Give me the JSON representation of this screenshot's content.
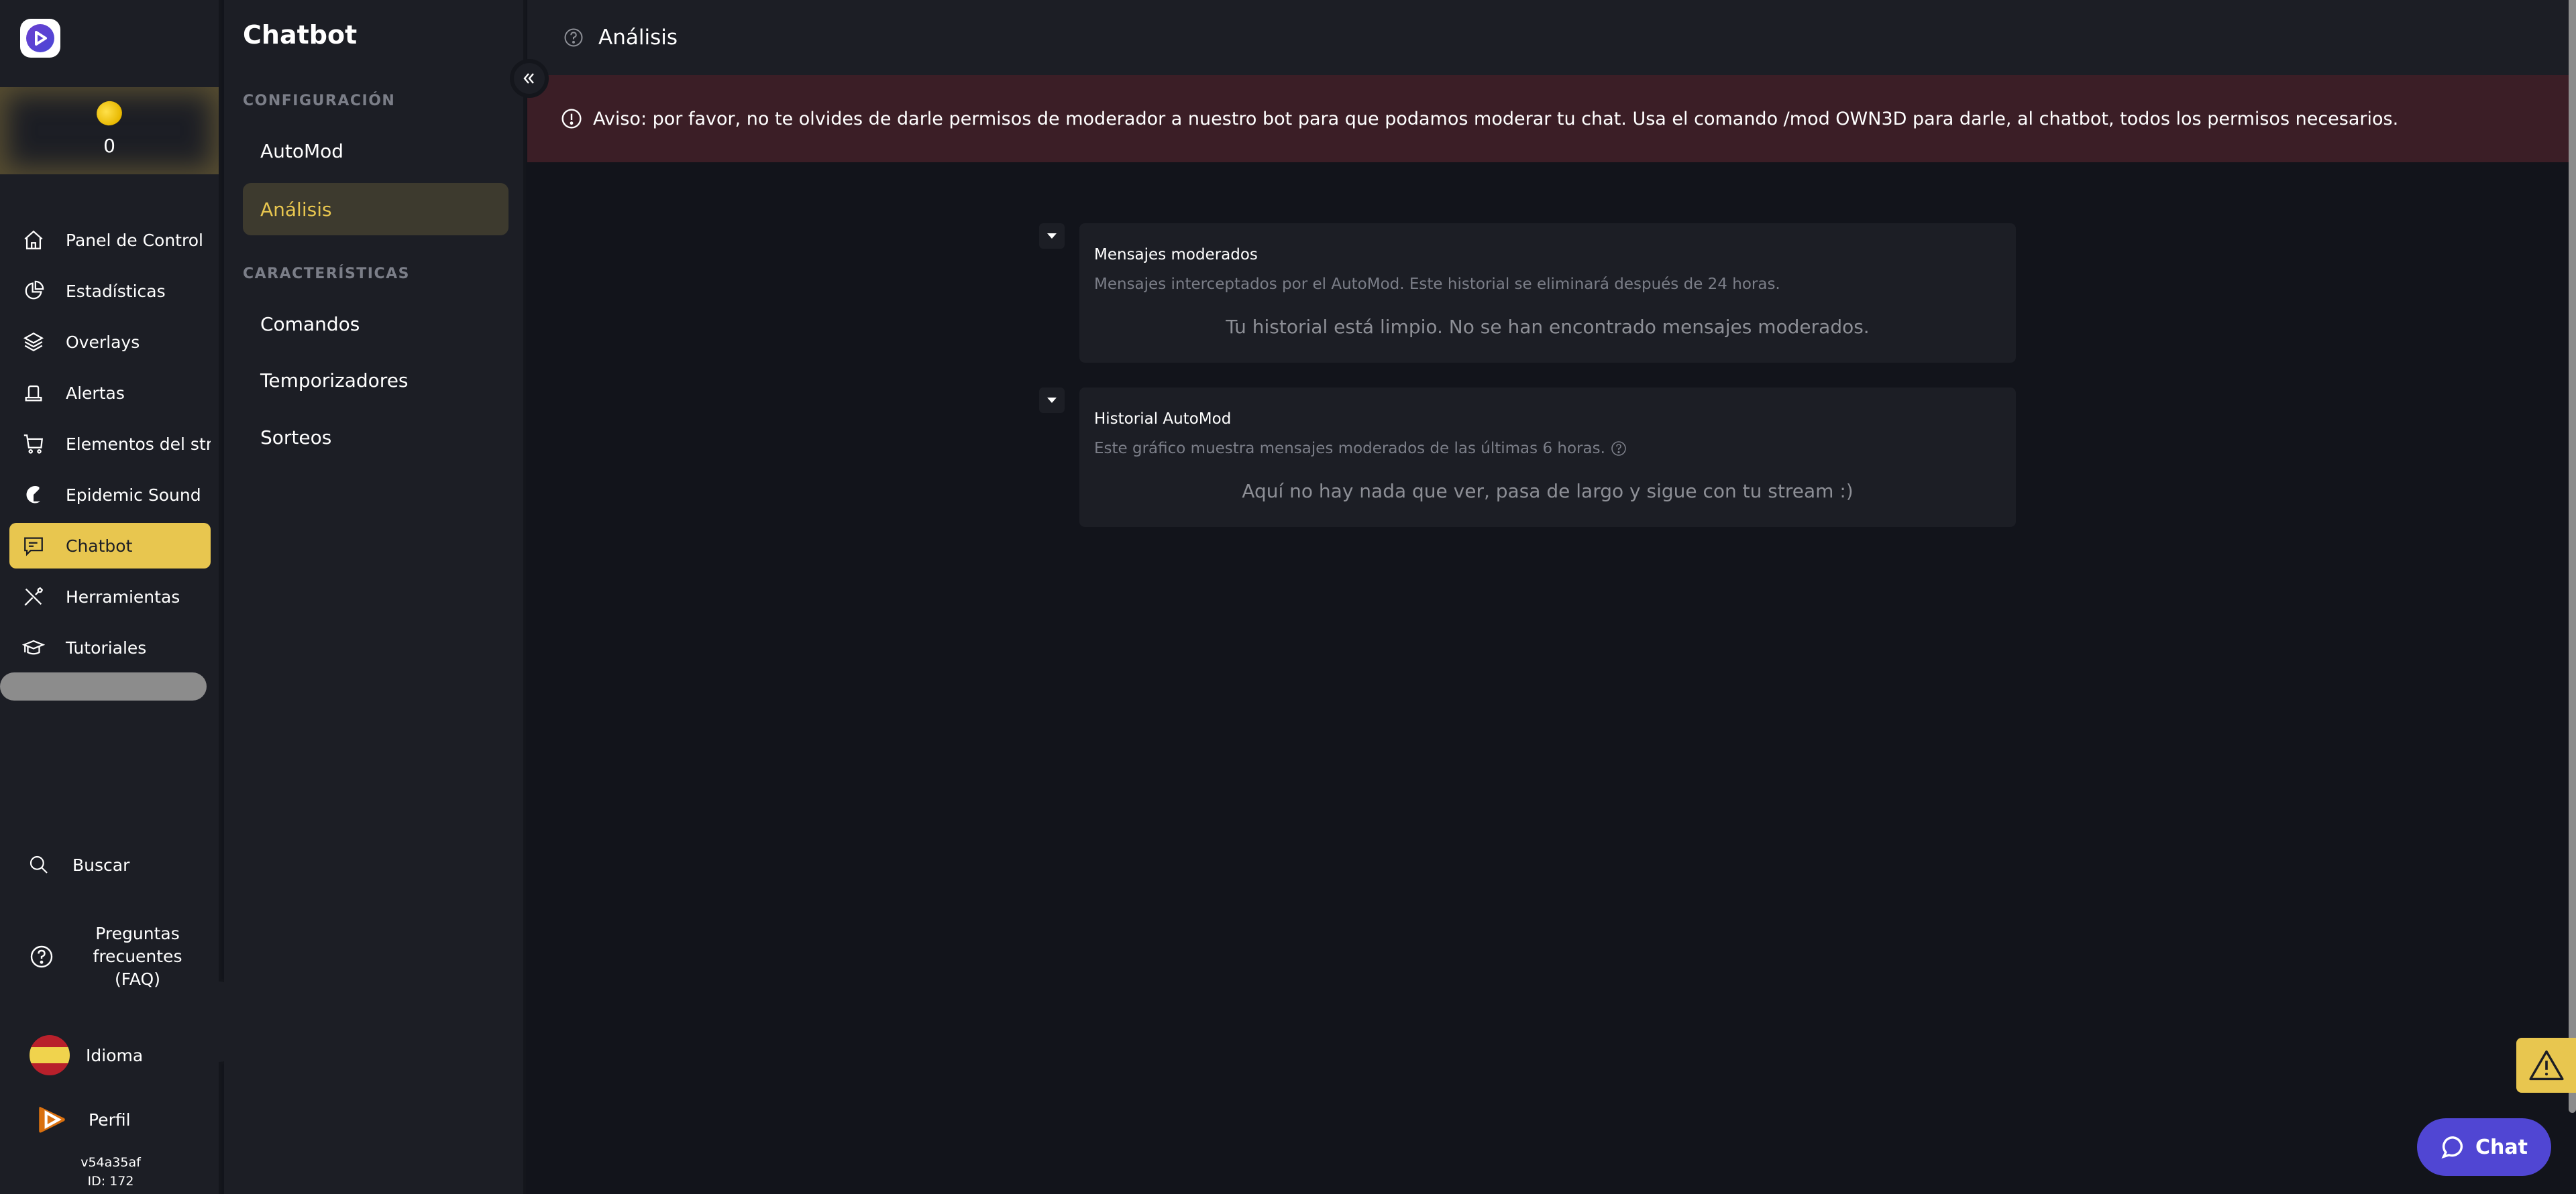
{
  "sidebar": {
    "logo": "own3d-logo-icon",
    "coins": {
      "icon": "coin-icon",
      "value": "0"
    },
    "nav": [
      {
        "label": "Panel de Control",
        "icon": "home-icon",
        "active": false
      },
      {
        "label": "Estadísticas",
        "icon": "pie-chart-icon",
        "active": false
      },
      {
        "label": "Overlays",
        "icon": "layers-icon",
        "active": false
      },
      {
        "label": "Alertas",
        "icon": "siren-icon",
        "active": false
      },
      {
        "label": "Elementos del strea",
        "icon": "cart-icon",
        "active": false
      },
      {
        "label": "Epidemic Sound",
        "icon": "epidemic-sound-icon",
        "active": false
      },
      {
        "label": "Chatbot",
        "icon": "chat-message-icon",
        "active": true
      },
      {
        "label": "Herramientas",
        "icon": "tools-icon",
        "active": false
      },
      {
        "label": "Tutoriales",
        "icon": "graduation-cap-icon",
        "active": false
      }
    ],
    "search_label": "Buscar",
    "faq_label": "Preguntas frecuentes (FAQ)",
    "faq_lines": [
      "Preguntas",
      "frecuentes",
      "(FAQ)"
    ],
    "language_label": "Idioma",
    "profile_label": "Perfil",
    "version": "v54a35af",
    "user_id": "ID: 172"
  },
  "subsidebar": {
    "title": "Chatbot",
    "sections": [
      {
        "label": "CONFIGURACIÓN",
        "items": [
          {
            "label": "AutoMod",
            "active": false
          },
          {
            "label": "Análisis",
            "active": true
          }
        ]
      },
      {
        "label": "CARACTERÍSTICAS",
        "items": [
          {
            "label": "Comandos",
            "active": false
          },
          {
            "label": "Temporizadores",
            "active": false
          },
          {
            "label": "Sorteos",
            "active": false
          }
        ]
      }
    ]
  },
  "header": {
    "title": "Análisis"
  },
  "banner": {
    "text": "Aviso: por favor, no te olvides de darle permisos de moderador a nuestro bot para que podamos moderar tu chat. Usa el comando /mod OWN3D para darle, al chatbot, todos los permisos necesarios."
  },
  "cards": [
    {
      "title": "Mensajes moderados",
      "subtitle": "Mensajes interceptados por el AutoMod. Este historial se eliminará después de 24 horas.",
      "empty": "Tu historial está limpio. No se han encontrado mensajes moderados."
    },
    {
      "title": "Historial AutoMod",
      "subtitle": "Este gráfico muestra mensajes moderados de las últimas 6 horas.",
      "empty": "Aquí no hay nada que ver, pasa de largo y sigue con tu stream :)"
    }
  ],
  "floating": {
    "chat_label": "Chat"
  },
  "colors": {
    "accent": "#e8c64f",
    "chat_button": "#5046d3",
    "banner_bg": "#3b1e26",
    "sidebar_bg": "#1c1e25",
    "main_bg": "#12141b"
  }
}
